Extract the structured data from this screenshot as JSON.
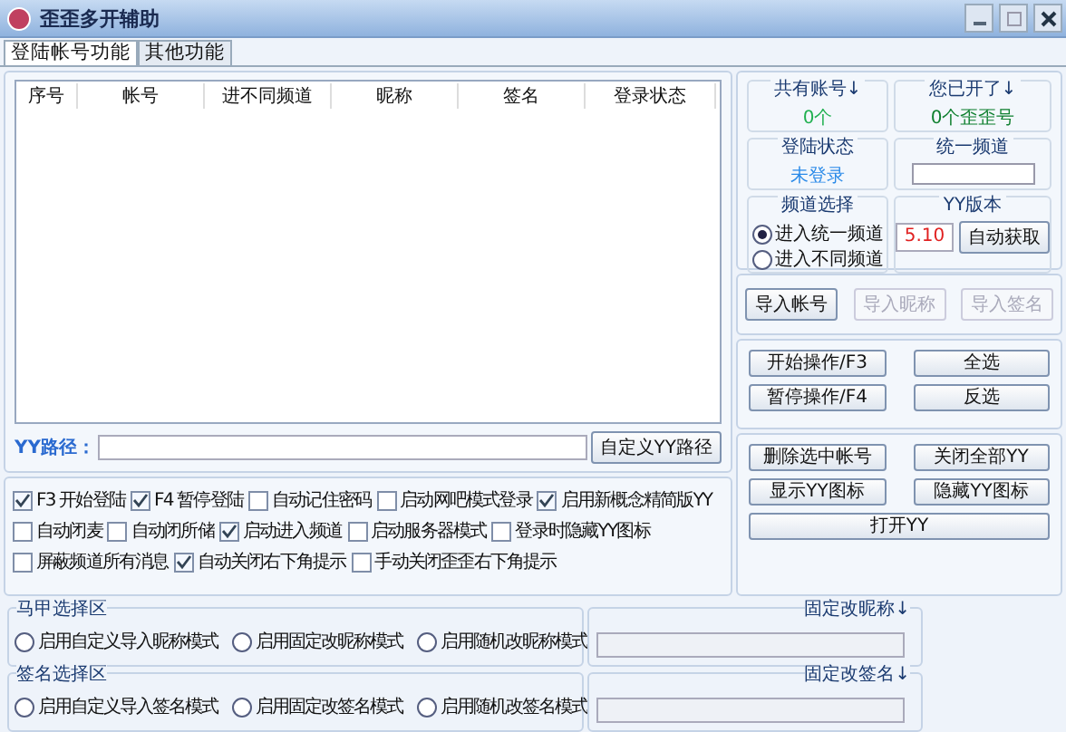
{
  "window": {
    "title": "歪歪多开辅助"
  },
  "tabs": [
    {
      "label": "登陆帐号功能",
      "selected": true
    },
    {
      "label": "其他功能",
      "selected": false
    }
  ],
  "table": {
    "columns": [
      "序号",
      "帐号",
      "进不同频道",
      "昵称",
      "签名",
      "登录状态"
    ]
  },
  "yy_path": {
    "label": "YY路径：",
    "button": "自定义YY路径"
  },
  "options": [
    [
      {
        "label": "F3 开始登陆",
        "checked": true
      },
      {
        "label": "F4 暂停登陆",
        "checked": true
      },
      {
        "label": "自动记住密码",
        "checked": false
      },
      {
        "label": "启动网吧模式登录",
        "checked": false
      },
      {
        "label": "启用新概念精简版YY",
        "checked": true
      }
    ],
    [
      {
        "label": "自动闭麦",
        "checked": false
      },
      {
        "label": "自动闭所储",
        "checked": false
      },
      {
        "label": "启动进入频道",
        "checked": true
      },
      {
        "label": "启动服务器模式",
        "checked": false
      },
      {
        "label": "登录时隐藏YY图标",
        "checked": false
      }
    ],
    [
      {
        "label": "屏蔽频道所有消息",
        "checked": false
      },
      {
        "label": "自动关闭右下角提示",
        "checked": true
      },
      {
        "label": "手动关闭歪歪右下角提示",
        "checked": false
      }
    ]
  ],
  "info": {
    "total_label": "共有账号↓",
    "total": "0个",
    "opened_label": "您已开了↓",
    "opened": "0个歪歪号",
    "status_label": "登陆状态",
    "status": "未登录",
    "channel_label": "统一频道",
    "mode_label": "频道选择",
    "modes": [
      {
        "label": "进入统一频道",
        "selected": true
      },
      {
        "label": "进入不同频道",
        "selected": false
      }
    ],
    "version_label": "YY版本",
    "version": "5.10",
    "auto_button": "自动获取"
  },
  "import_buttons": [
    {
      "label": "导入帐号",
      "disabled": false
    },
    {
      "label": "导入昵称",
      "disabled": true
    },
    {
      "label": "导入签名",
      "disabled": true
    }
  ],
  "action_buttons": [
    [
      "开始操作/F3",
      "全选"
    ],
    [
      "暂停操作/F4",
      "反选"
    ]
  ],
  "yy_buttons": [
    [
      "删除选中帐号",
      "关闭全部YY"
    ],
    [
      "显示YY图标",
      "隐藏YY图标"
    ],
    [
      "打开YY"
    ]
  ],
  "groups": [
    {
      "title": "马甲选择区",
      "modes": [
        {
          "label": "启用自定义导入昵称模式",
          "selected": false
        },
        {
          "label": "启用固定改昵称模式",
          "selected": false
        },
        {
          "label": "启用随机改昵称模式",
          "selected": false
        }
      ],
      "field_label": "固定改昵称↓"
    },
    {
      "title": "签名选择区",
      "modes": [
        {
          "label": "启用自定义导入签名模式",
          "selected": false
        },
        {
          "label": "启用固定改签名模式",
          "selected": false
        },
        {
          "label": "启用随机改签名模式",
          "selected": false
        }
      ],
      "field_label": "固定改签名↓"
    }
  ]
}
